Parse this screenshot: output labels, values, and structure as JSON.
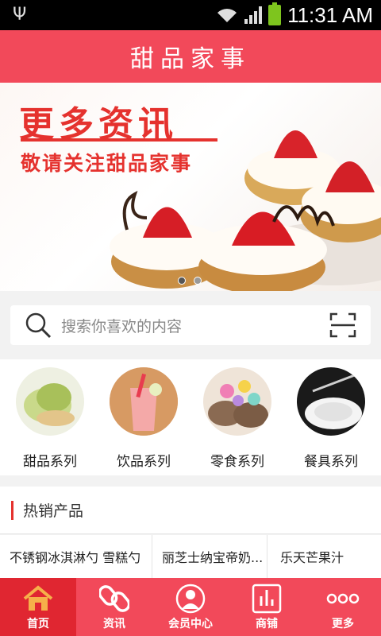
{
  "status_bar": {
    "time": "11:31 AM",
    "usb_icon": "usb-icon"
  },
  "header": {
    "title": "甜品家事"
  },
  "banner": {
    "headline": "更多资讯",
    "subline": "敬请关注甜品家事",
    "slide_count": 2,
    "active_slide": 1
  },
  "search": {
    "placeholder": "搜索你喜欢的内容"
  },
  "categories": [
    {
      "label": "甜品系列"
    },
    {
      "label": "饮品系列"
    },
    {
      "label": "零食系列"
    },
    {
      "label": "餐具系列"
    }
  ],
  "hot_section": {
    "title": "热销产品"
  },
  "products": [
    {
      "name": "不锈钢冰淇淋勺 雪糕勺"
    },
    {
      "name": "丽芝士纳宝帝奶..."
    },
    {
      "name": "乐天芒果汁"
    }
  ],
  "tabs": [
    {
      "label": "首页",
      "icon": "home-icon",
      "active": true
    },
    {
      "label": "资讯",
      "icon": "link-icon",
      "active": false
    },
    {
      "label": "会员中心",
      "icon": "user-icon",
      "active": false
    },
    {
      "label": "商铺",
      "icon": "chart-icon",
      "active": false
    },
    {
      "label": "更多",
      "icon": "more-icon",
      "active": false
    }
  ],
  "colors": {
    "brand": "#f2495a",
    "active_tab": "#e02631",
    "accent_red": "#e5322e"
  }
}
